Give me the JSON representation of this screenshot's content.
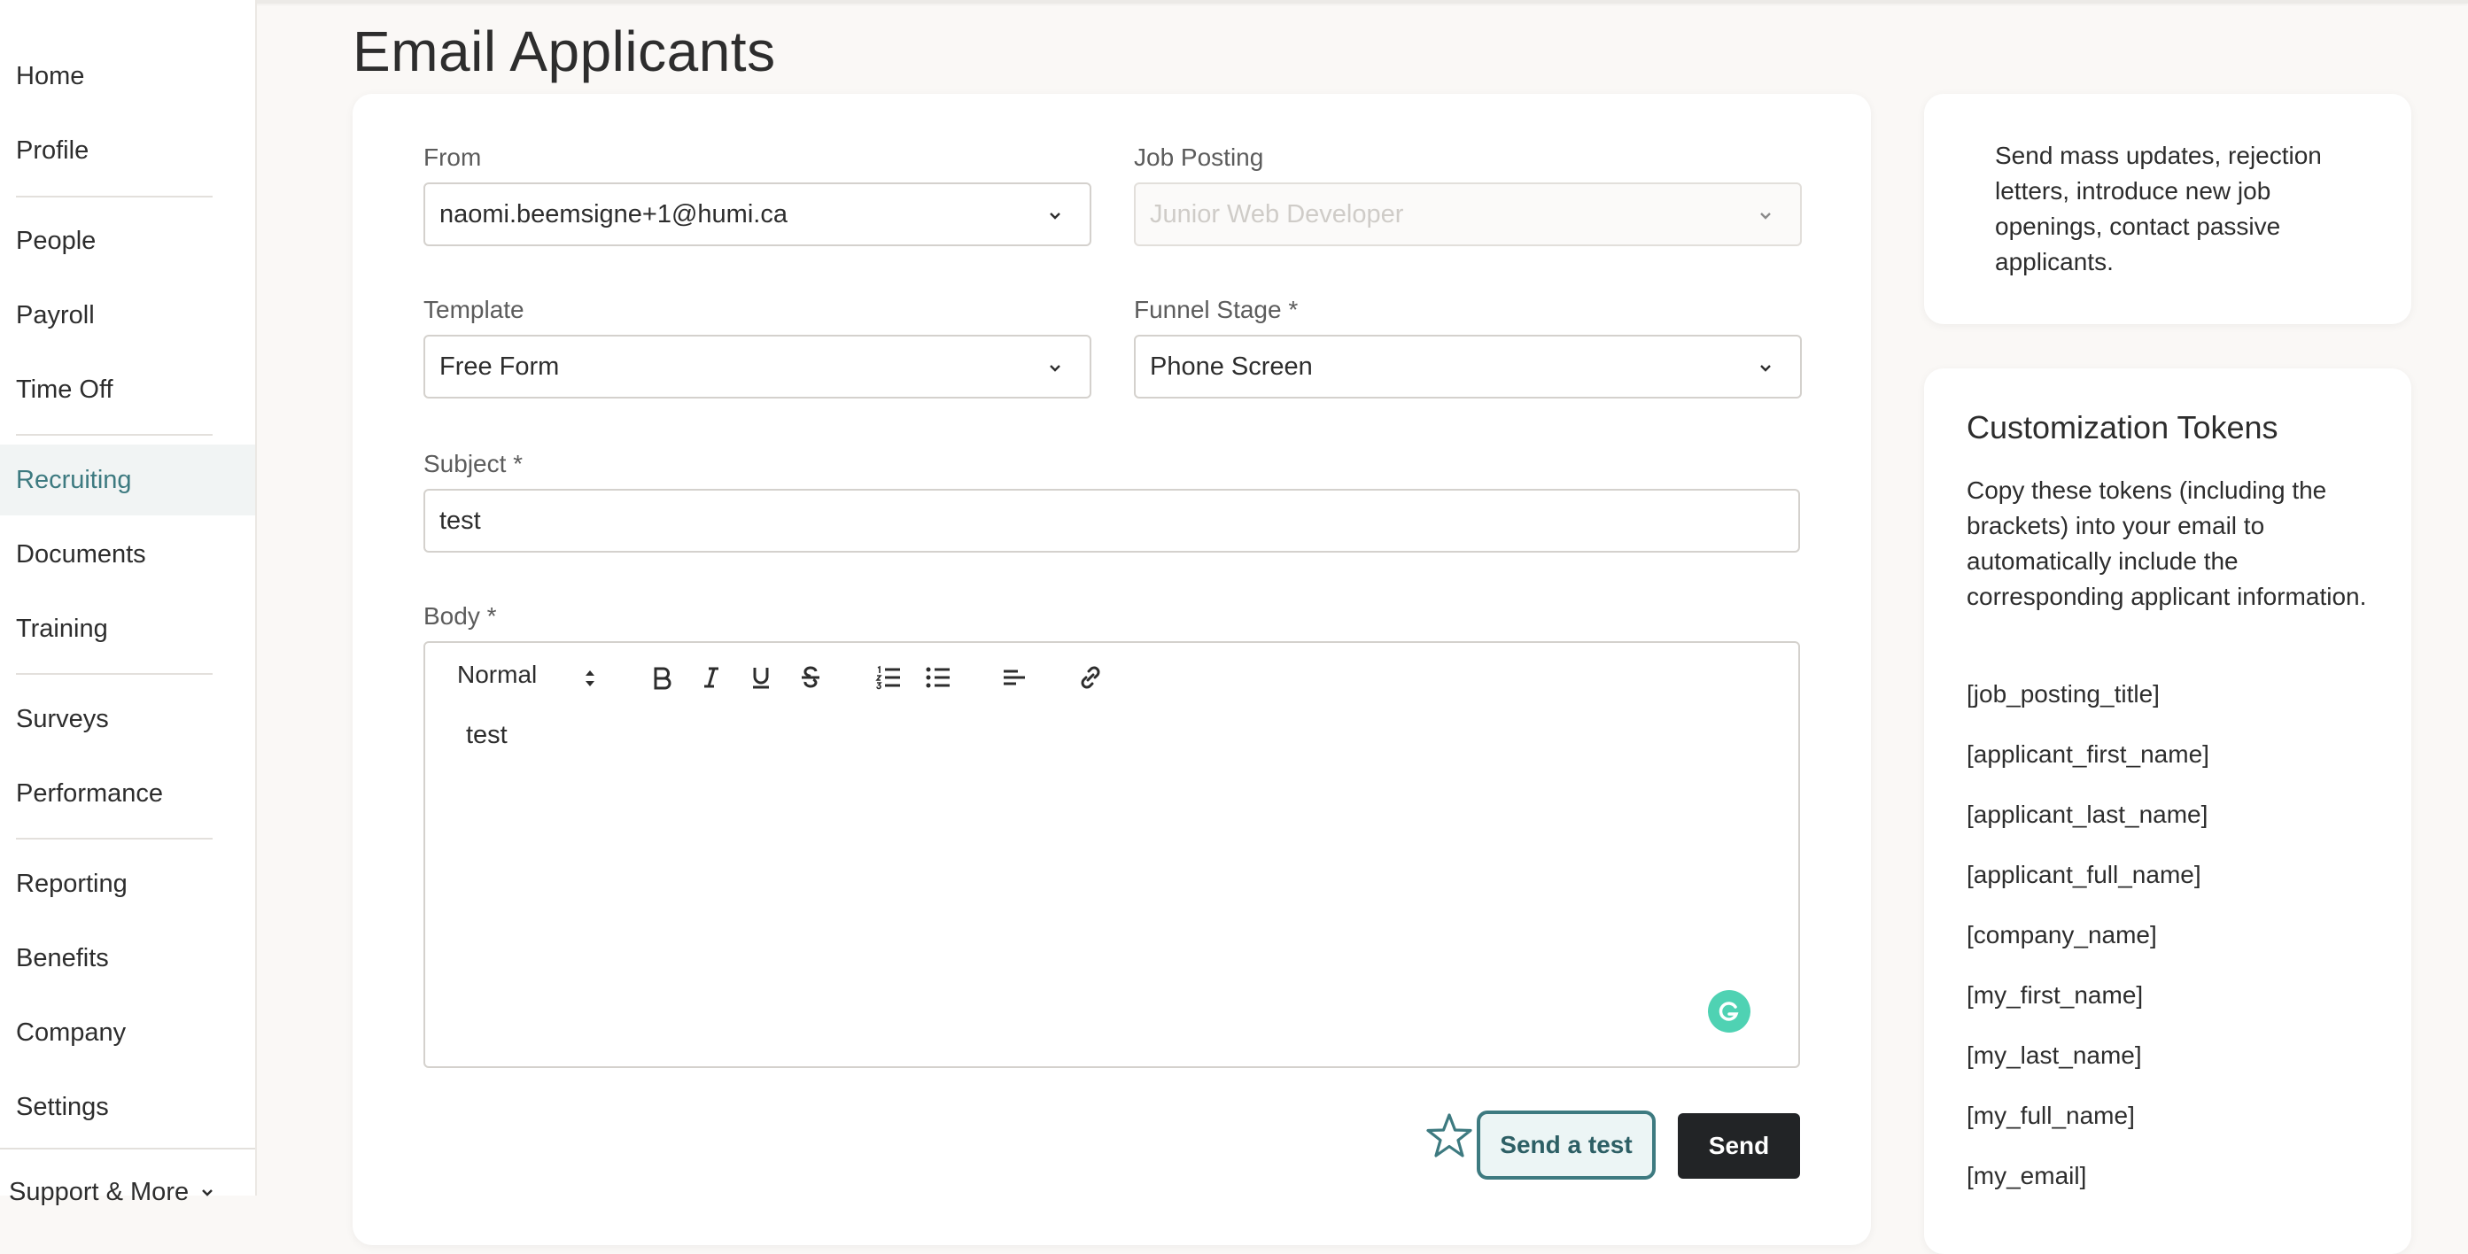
{
  "page_title": "Email Applicants",
  "sidebar": {
    "items": [
      {
        "label": "Home"
      },
      {
        "label": "Profile"
      },
      {
        "label": "People"
      },
      {
        "label": "Payroll"
      },
      {
        "label": "Time Off"
      },
      {
        "label": "Recruiting"
      },
      {
        "label": "Documents"
      },
      {
        "label": "Training"
      },
      {
        "label": "Surveys"
      },
      {
        "label": "Performance"
      },
      {
        "label": "Reporting"
      },
      {
        "label": "Benefits"
      },
      {
        "label": "Company"
      },
      {
        "label": "Settings"
      }
    ],
    "active": "Recruiting",
    "support_label": "Support & More"
  },
  "form": {
    "from": {
      "label": "From",
      "value": "naomi.beemsigne+1@humi.ca"
    },
    "job_posting": {
      "label": "Job Posting",
      "value": "Junior Web Developer"
    },
    "template": {
      "label": "Template",
      "value": "Free Form"
    },
    "funnel_stage": {
      "label": "Funnel Stage *",
      "value": "Phone Screen"
    },
    "subject": {
      "label": "Subject *",
      "value": "test"
    },
    "body": {
      "label": "Body *",
      "value": "test",
      "format": "Normal"
    }
  },
  "actions": {
    "send_test_label": "Send a test",
    "send_label": "Send"
  },
  "info": {
    "text": "Send mass updates, rejection letters, introduce new job openings, contact passive applicants."
  },
  "tokens": {
    "title": "Customization Tokens",
    "description": "Copy these tokens (including the brackets) into your email to automatically include the corresponding applicant information.",
    "items": [
      "[job_posting_title]",
      "[applicant_first_name]",
      "[applicant_last_name]",
      "[applicant_full_name]",
      "[company_name]",
      "[my_first_name]",
      "[my_last_name]",
      "[my_full_name]",
      "[my_email]"
    ]
  },
  "colors": {
    "accent": "#3d7a80",
    "send_button": "#222426",
    "grammarly": "#15c39a"
  }
}
